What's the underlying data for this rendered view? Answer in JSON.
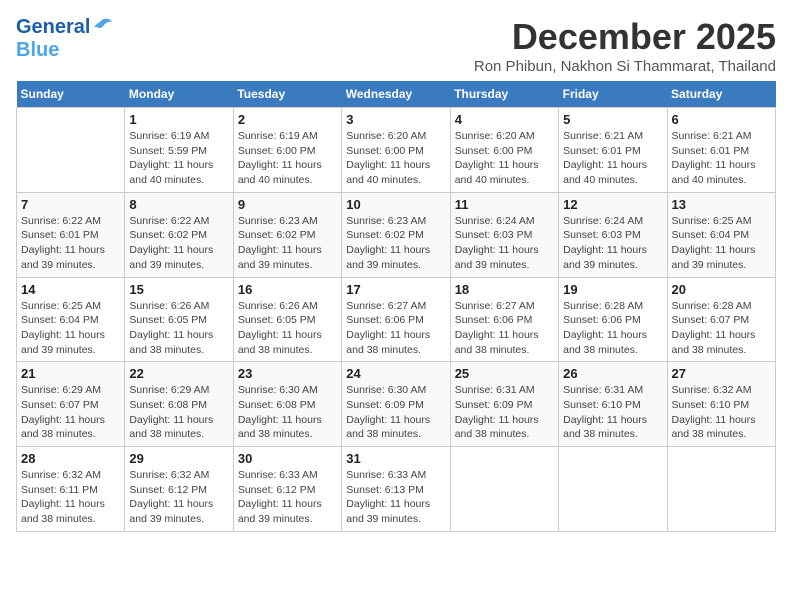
{
  "logo": {
    "line1": "General",
    "line2": "Blue"
  },
  "title": "December 2025",
  "subtitle": "Ron Phibun, Nakhon Si Thammarat, Thailand",
  "days_of_week": [
    "Sunday",
    "Monday",
    "Tuesday",
    "Wednesday",
    "Thursday",
    "Friday",
    "Saturday"
  ],
  "weeks": [
    [
      {
        "day": "",
        "sunrise": "",
        "sunset": "",
        "daylight": ""
      },
      {
        "day": "1",
        "sunrise": "Sunrise: 6:19 AM",
        "sunset": "Sunset: 5:59 PM",
        "daylight": "Daylight: 11 hours and 40 minutes."
      },
      {
        "day": "2",
        "sunrise": "Sunrise: 6:19 AM",
        "sunset": "Sunset: 6:00 PM",
        "daylight": "Daylight: 11 hours and 40 minutes."
      },
      {
        "day": "3",
        "sunrise": "Sunrise: 6:20 AM",
        "sunset": "Sunset: 6:00 PM",
        "daylight": "Daylight: 11 hours and 40 minutes."
      },
      {
        "day": "4",
        "sunrise": "Sunrise: 6:20 AM",
        "sunset": "Sunset: 6:00 PM",
        "daylight": "Daylight: 11 hours and 40 minutes."
      },
      {
        "day": "5",
        "sunrise": "Sunrise: 6:21 AM",
        "sunset": "Sunset: 6:01 PM",
        "daylight": "Daylight: 11 hours and 40 minutes."
      },
      {
        "day": "6",
        "sunrise": "Sunrise: 6:21 AM",
        "sunset": "Sunset: 6:01 PM",
        "daylight": "Daylight: 11 hours and 40 minutes."
      }
    ],
    [
      {
        "day": "7",
        "sunrise": "Sunrise: 6:22 AM",
        "sunset": "Sunset: 6:01 PM",
        "daylight": "Daylight: 11 hours and 39 minutes."
      },
      {
        "day": "8",
        "sunrise": "Sunrise: 6:22 AM",
        "sunset": "Sunset: 6:02 PM",
        "daylight": "Daylight: 11 hours and 39 minutes."
      },
      {
        "day": "9",
        "sunrise": "Sunrise: 6:23 AM",
        "sunset": "Sunset: 6:02 PM",
        "daylight": "Daylight: 11 hours and 39 minutes."
      },
      {
        "day": "10",
        "sunrise": "Sunrise: 6:23 AM",
        "sunset": "Sunset: 6:02 PM",
        "daylight": "Daylight: 11 hours and 39 minutes."
      },
      {
        "day": "11",
        "sunrise": "Sunrise: 6:24 AM",
        "sunset": "Sunset: 6:03 PM",
        "daylight": "Daylight: 11 hours and 39 minutes."
      },
      {
        "day": "12",
        "sunrise": "Sunrise: 6:24 AM",
        "sunset": "Sunset: 6:03 PM",
        "daylight": "Daylight: 11 hours and 39 minutes."
      },
      {
        "day": "13",
        "sunrise": "Sunrise: 6:25 AM",
        "sunset": "Sunset: 6:04 PM",
        "daylight": "Daylight: 11 hours and 39 minutes."
      }
    ],
    [
      {
        "day": "14",
        "sunrise": "Sunrise: 6:25 AM",
        "sunset": "Sunset: 6:04 PM",
        "daylight": "Daylight: 11 hours and 39 minutes."
      },
      {
        "day": "15",
        "sunrise": "Sunrise: 6:26 AM",
        "sunset": "Sunset: 6:05 PM",
        "daylight": "Daylight: 11 hours and 38 minutes."
      },
      {
        "day": "16",
        "sunrise": "Sunrise: 6:26 AM",
        "sunset": "Sunset: 6:05 PM",
        "daylight": "Daylight: 11 hours and 38 minutes."
      },
      {
        "day": "17",
        "sunrise": "Sunrise: 6:27 AM",
        "sunset": "Sunset: 6:06 PM",
        "daylight": "Daylight: 11 hours and 38 minutes."
      },
      {
        "day": "18",
        "sunrise": "Sunrise: 6:27 AM",
        "sunset": "Sunset: 6:06 PM",
        "daylight": "Daylight: 11 hours and 38 minutes."
      },
      {
        "day": "19",
        "sunrise": "Sunrise: 6:28 AM",
        "sunset": "Sunset: 6:06 PM",
        "daylight": "Daylight: 11 hours and 38 minutes."
      },
      {
        "day": "20",
        "sunrise": "Sunrise: 6:28 AM",
        "sunset": "Sunset: 6:07 PM",
        "daylight": "Daylight: 11 hours and 38 minutes."
      }
    ],
    [
      {
        "day": "21",
        "sunrise": "Sunrise: 6:29 AM",
        "sunset": "Sunset: 6:07 PM",
        "daylight": "Daylight: 11 hours and 38 minutes."
      },
      {
        "day": "22",
        "sunrise": "Sunrise: 6:29 AM",
        "sunset": "Sunset: 6:08 PM",
        "daylight": "Daylight: 11 hours and 38 minutes."
      },
      {
        "day": "23",
        "sunrise": "Sunrise: 6:30 AM",
        "sunset": "Sunset: 6:08 PM",
        "daylight": "Daylight: 11 hours and 38 minutes."
      },
      {
        "day": "24",
        "sunrise": "Sunrise: 6:30 AM",
        "sunset": "Sunset: 6:09 PM",
        "daylight": "Daylight: 11 hours and 38 minutes."
      },
      {
        "day": "25",
        "sunrise": "Sunrise: 6:31 AM",
        "sunset": "Sunset: 6:09 PM",
        "daylight": "Daylight: 11 hours and 38 minutes."
      },
      {
        "day": "26",
        "sunrise": "Sunrise: 6:31 AM",
        "sunset": "Sunset: 6:10 PM",
        "daylight": "Daylight: 11 hours and 38 minutes."
      },
      {
        "day": "27",
        "sunrise": "Sunrise: 6:32 AM",
        "sunset": "Sunset: 6:10 PM",
        "daylight": "Daylight: 11 hours and 38 minutes."
      }
    ],
    [
      {
        "day": "28",
        "sunrise": "Sunrise: 6:32 AM",
        "sunset": "Sunset: 6:11 PM",
        "daylight": "Daylight: 11 hours and 38 minutes."
      },
      {
        "day": "29",
        "sunrise": "Sunrise: 6:32 AM",
        "sunset": "Sunset: 6:12 PM",
        "daylight": "Daylight: 11 hours and 39 minutes."
      },
      {
        "day": "30",
        "sunrise": "Sunrise: 6:33 AM",
        "sunset": "Sunset: 6:12 PM",
        "daylight": "Daylight: 11 hours and 39 minutes."
      },
      {
        "day": "31",
        "sunrise": "Sunrise: 6:33 AM",
        "sunset": "Sunset: 6:13 PM",
        "daylight": "Daylight: 11 hours and 39 minutes."
      },
      {
        "day": "",
        "sunrise": "",
        "sunset": "",
        "daylight": ""
      },
      {
        "day": "",
        "sunrise": "",
        "sunset": "",
        "daylight": ""
      },
      {
        "day": "",
        "sunrise": "",
        "sunset": "",
        "daylight": ""
      }
    ]
  ]
}
